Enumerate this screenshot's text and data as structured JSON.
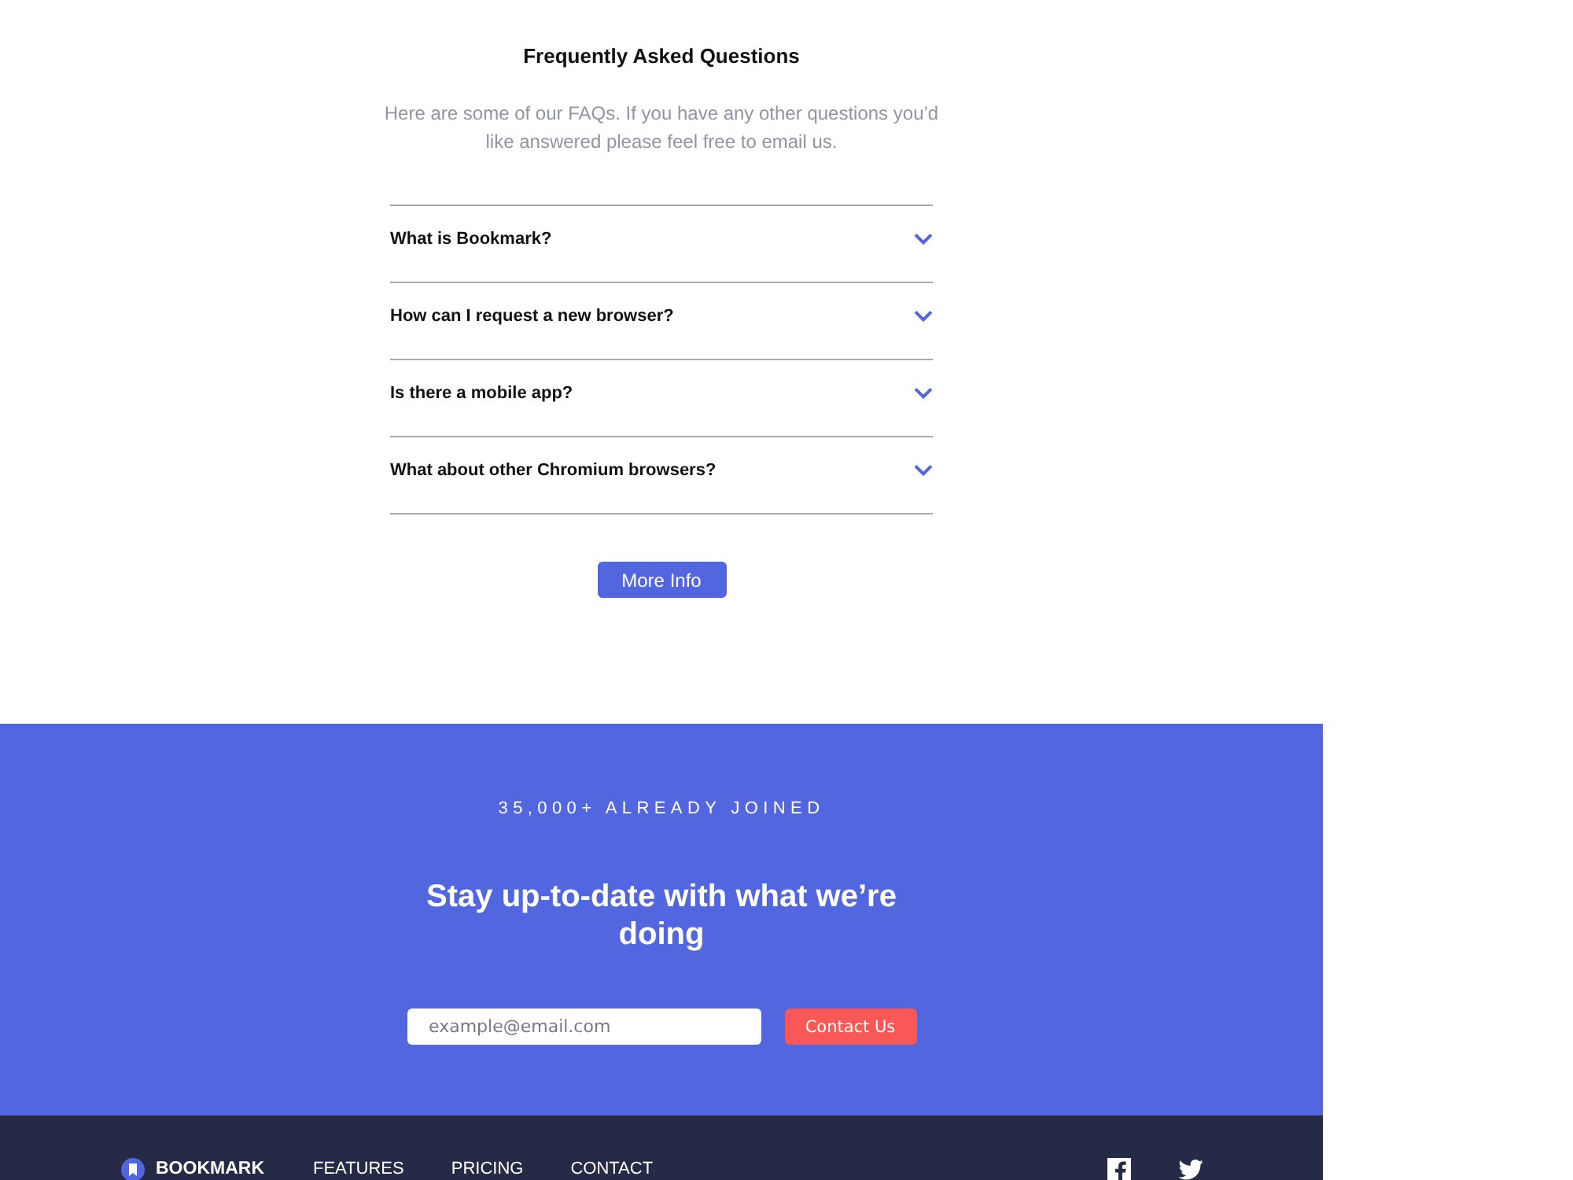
{
  "faq": {
    "title": "Frequently Asked Questions",
    "intro": "Here are some of our FAQs. If you have any other questions you’d like answered please feel free to email us.",
    "questions": [
      {
        "question": "What is Bookmark?",
        "expanded": false
      },
      {
        "question": "How can I request a new browser?",
        "expanded": false
      },
      {
        "question": "Is there a mobile app?",
        "expanded": false
      },
      {
        "question": "What about other Chromium browsers?",
        "expanded": false
      }
    ],
    "button": "More Info"
  },
  "signup": {
    "eyebrow": "35,000+ ALREADY JOINED",
    "heading": "Stay up-to-date with what we’re doing",
    "email": {
      "placeholder": "example@email.com"
    },
    "button": "Contact Us"
  },
  "footer": {
    "logo": "BOOKMARK",
    "nav": [
      "FEATURES",
      "PRICING",
      "CONTACT"
    ]
  }
}
